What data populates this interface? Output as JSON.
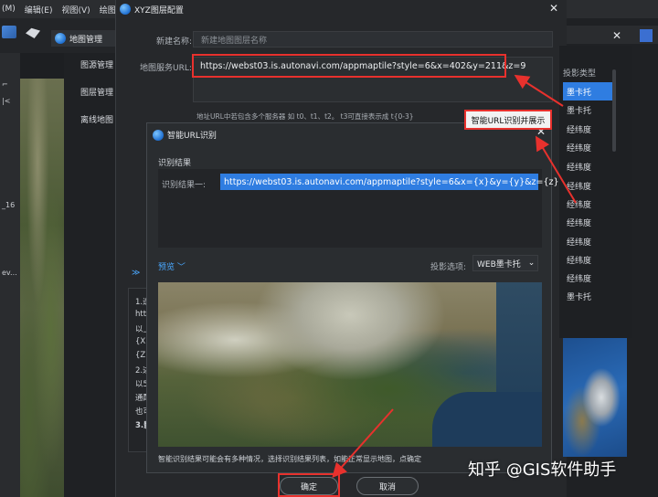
{
  "app_menu": {
    "items": [
      "(M)",
      "编辑(E)",
      "视图(V)",
      "绘图("
    ]
  },
  "map_manager": {
    "title": "地图管理",
    "items": [
      "图源管理",
      "图层管理",
      "离线地图"
    ]
  },
  "left_ruler": {
    "ticks": [
      "_16",
      "ev..."
    ]
  },
  "xyz_dialog": {
    "title": "XYZ图层配置",
    "name_label": "新建名称:",
    "name_placeholder": "新建地图图层名称",
    "url_label": "地图服务URL:",
    "url_value": "https://webst03.is.autonavi.com/appmaptile?style=6&x=402&y=211&z=9",
    "url_hint": "地址URL中若包含多个服务器 如 t0、t1、t2。 t3可直接表示成 t{0-3}",
    "proj_header": "投影类型",
    "proj_items": [
      "墨卡托",
      "墨卡托",
      "经纬度",
      "经纬度",
      "经纬度",
      "经纬度",
      "经纬度",
      "经纬度",
      "经纬度",
      "经纬度",
      "经纬度",
      "墨卡托"
    ],
    "confirm_label": "确定",
    "cancel_label": "取消"
  },
  "help_text": {
    "lines": [
      "1.迭",
      "htt",
      "以上",
      "{X}",
      "{Z}",
      "2.述",
      "以5",
      "通配",
      "也可",
      "3.影"
    ],
    "expand": "≫"
  },
  "smart_dialog": {
    "title": "智能URL识别",
    "section": "识别结果",
    "result_label": "识别结果一:",
    "result_value": "https://webst03.is.autonavi.com/appmaptile?style=6&x={x}&y={y}&z={z}",
    "preview_label": "预览",
    "proj_option_label": "投影选项:",
    "proj_option_value": "WEB墨卡托",
    "notice": "智能识别结果可能会有多种情况，选择识别结果列表，如能正常显示地图，点确定"
  },
  "annotations": {
    "smart_label": "智能URL识别并展示",
    "accent_color": "#e8312d"
  },
  "watermark": "知乎 @GIS软件助手"
}
